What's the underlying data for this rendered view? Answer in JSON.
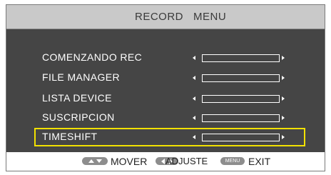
{
  "title": {
    "word1": "RECORD",
    "word2": "MENU"
  },
  "menu": {
    "items": [
      {
        "label": "COMENZANDO REC",
        "level": 0,
        "selected": false
      },
      {
        "label": "FILE MANAGER",
        "level": 0,
        "selected": false
      },
      {
        "label": "LISTA DEVICE",
        "level": 0,
        "selected": false
      },
      {
        "label": "SUSCRIPCION",
        "level": 0,
        "selected": false
      },
      {
        "label": "TIMESHIFT",
        "level": 0,
        "selected": true
      }
    ]
  },
  "footer": {
    "move_label": "MOVER",
    "adjust_label": "ADJUSTE",
    "menu_key_label": "MENU",
    "exit_label": "EXIT"
  },
  "colors": {
    "panel": "#454545",
    "title_bar": "#c9c9c9",
    "highlight": "#f2e100",
    "key_button": "#8d8d8d"
  },
  "icons": [
    "up-down-keys-icon",
    "left-right-keys-icon",
    "menu-key-icon",
    "arrow-left-icon",
    "arrow-right-icon"
  ]
}
